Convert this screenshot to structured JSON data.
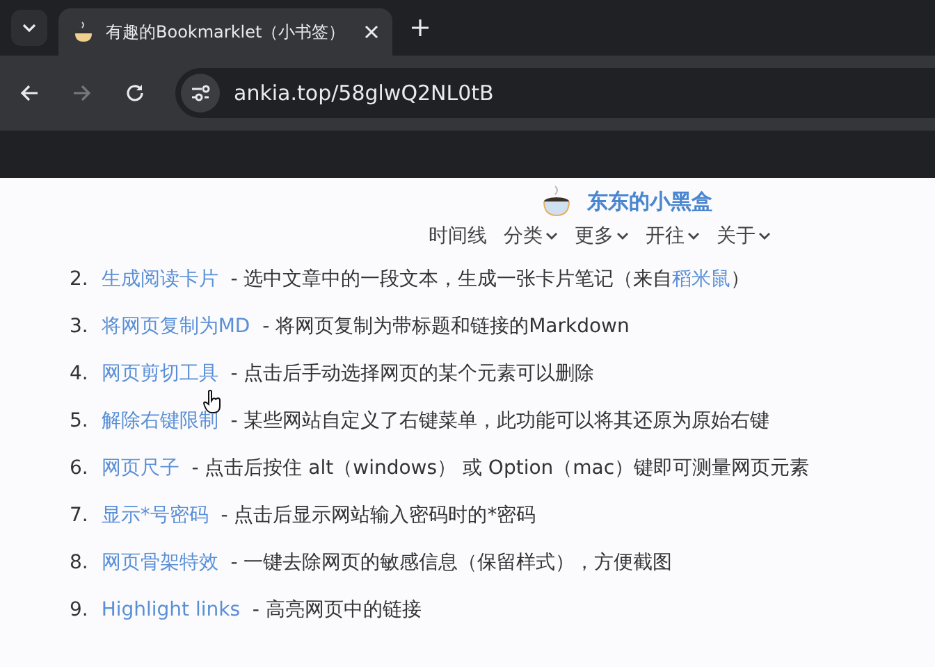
{
  "browser": {
    "tab": {
      "title": "有趣的Bookmarklet（小书签）",
      "selected": true
    },
    "url": "ankia.top/58glwQ2NL0tB"
  },
  "site": {
    "title": "东东的小黑盒",
    "nav": [
      {
        "label": "时间线",
        "dropdown": false
      },
      {
        "label": "分类",
        "dropdown": true
      },
      {
        "label": "更多",
        "dropdown": true
      },
      {
        "label": "开往",
        "dropdown": true
      },
      {
        "label": "关于",
        "dropdown": true
      }
    ]
  },
  "items": [
    {
      "number": "2.",
      "title": "生成阅读卡片",
      "parts": [
        {
          "kind": "text",
          "text": " - 选中文章中的一段文本，生成一张卡片笔记（来自"
        },
        {
          "kind": "link",
          "text": "稻米鼠"
        },
        {
          "kind": "text",
          "text": "）"
        }
      ]
    },
    {
      "number": "3.",
      "title": "将网页复制为MD",
      "parts": [
        {
          "kind": "text",
          "text": " - 将网页复制为带标题和链接的Markdown"
        }
      ]
    },
    {
      "number": "4.",
      "title": "网页剪切工具",
      "parts": [
        {
          "kind": "text",
          "text": " - 点击后手动选择网页的某个元素可以删除"
        }
      ]
    },
    {
      "number": "5.",
      "title": "解除右键限制",
      "parts": [
        {
          "kind": "text",
          "text": " - 某些网站自定义了右键菜单，此功能可以将其还原为原始右键"
        }
      ]
    },
    {
      "number": "6.",
      "title": "网页尺子",
      "parts": [
        {
          "kind": "text",
          "text": " - 点击后按住 alt（windows） 或 Option（mac）键即可测量网页元素"
        }
      ]
    },
    {
      "number": "7.",
      "title": "显示*号密码",
      "parts": [
        {
          "kind": "text",
          "text": " - 点击后显示网站输入密码时的*密码"
        }
      ]
    },
    {
      "number": "8.",
      "title": "网页骨架特效",
      "parts": [
        {
          "kind": "text",
          "text": " - 一键去除网页的敏感信息（保留样式），方便截图"
        }
      ]
    },
    {
      "number": "9.",
      "title": "Highlight links",
      "parts": [
        {
          "kind": "text",
          "text": " - 高亮网页中的链接"
        }
      ]
    }
  ]
}
